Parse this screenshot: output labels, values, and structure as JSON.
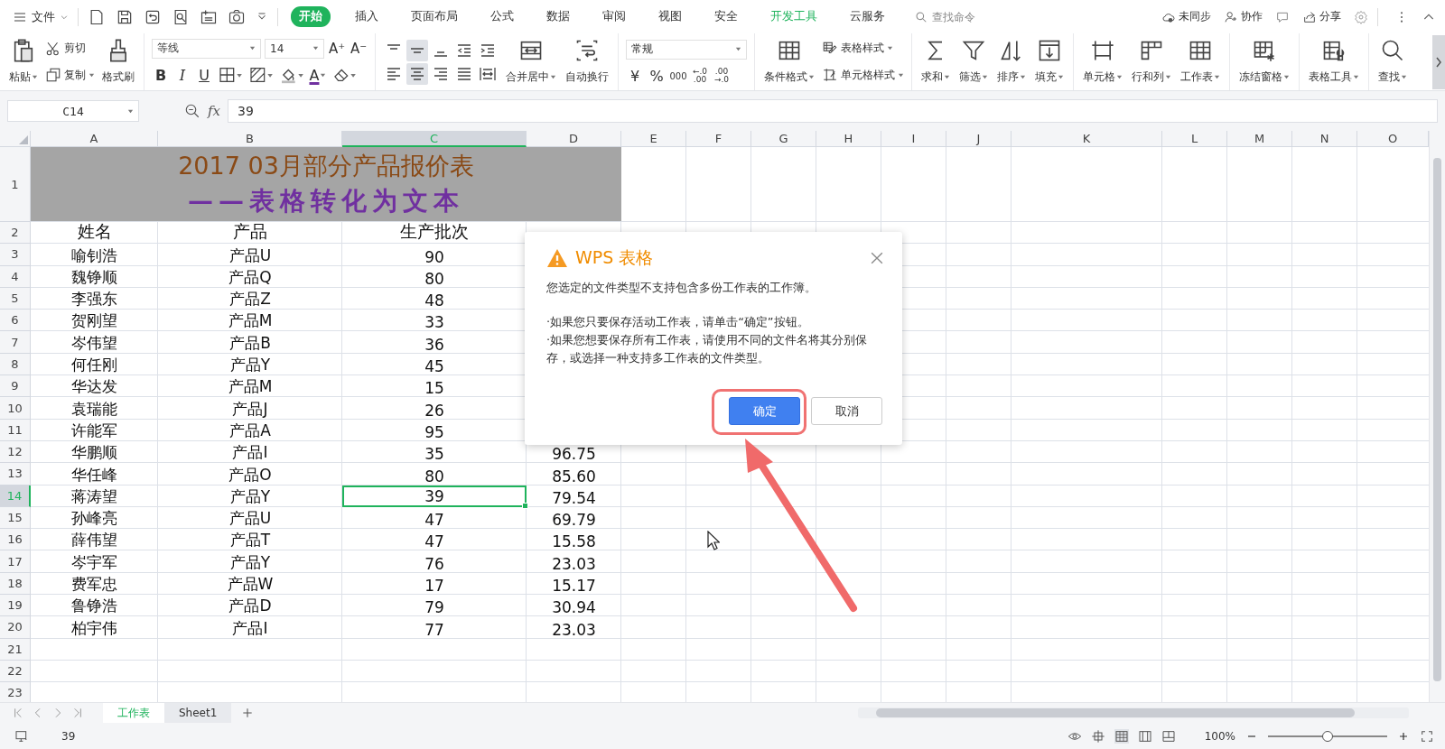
{
  "menu_bar": {
    "file_menu": "文件",
    "tabs": [
      {
        "label": "开始",
        "selected": true,
        "kind": "normal"
      },
      {
        "label": "插入",
        "selected": false,
        "kind": "normal"
      },
      {
        "label": "页面布局",
        "selected": false,
        "kind": "normal"
      },
      {
        "label": "公式",
        "selected": false,
        "kind": "normal"
      },
      {
        "label": "数据",
        "selected": false,
        "kind": "normal"
      },
      {
        "label": "审阅",
        "selected": false,
        "kind": "normal"
      },
      {
        "label": "视图",
        "selected": false,
        "kind": "normal"
      },
      {
        "label": "安全",
        "selected": false,
        "kind": "normal"
      },
      {
        "label": "开发工具",
        "selected": false,
        "kind": "accent"
      },
      {
        "label": "云服务",
        "selected": false,
        "kind": "normal"
      }
    ],
    "search": {
      "placeholder": "查找命令"
    },
    "actions": [
      "未同步",
      "协作",
      "分享"
    ]
  },
  "ribbon": {
    "groups": [
      {
        "items": [
          {
            "kind": "large",
            "label": "粘贴",
            "dropdown": true
          },
          {
            "kind": "stack",
            "items": [
              {
                "label": "剪切",
                "dropdown": false
              },
              {
                "label": "复制",
                "dropdown": true
              }
            ]
          },
          {
            "kind": "large",
            "label": "格式刷",
            "dropdown": false
          }
        ]
      },
      {
        "items": [
          {
            "kind": "font",
            "font": "等线",
            "size": "14",
            "size_buttons": [
              "A⁺",
              "A⁻"
            ],
            "styles": [
              "B",
              "I",
              "U"
            ],
            "font_color_glyph": "A"
          }
        ]
      },
      {
        "items": [
          {
            "kind": "align",
            "buttons": [
              {
                "selected": false
              },
              {
                "selected": true
              },
              {
                "selected": false
              },
              {
                "selected": false
              },
              {
                "selected": false
              },
              {
                "selected": false
              },
              {
                "selected": true
              },
              {
                "selected": false
              },
              {
                "selected": false
              },
              {
                "selected": false
              }
            ]
          },
          {
            "kind": "large",
            "label": "合并居中",
            "dropdown": true
          },
          {
            "kind": "large",
            "label": "自动换行",
            "dropdown": false
          }
        ]
      },
      {
        "items": [
          {
            "kind": "number",
            "format": "常规",
            "symbols": [
              "¥",
              "%"
            ],
            "thousands": "000",
            "decimals": [
              {
                "top": "←.0",
                "bottom": ".00"
              },
              {
                "top": ".00",
                "bottom": "→.0"
              }
            ]
          }
        ]
      },
      {
        "items": [
          {
            "kind": "large",
            "label": "条件格式",
            "dropdown": true
          },
          {
            "kind": "stack",
            "items": [
              {
                "label": "表格样式",
                "dropdown": true
              },
              {
                "label": "单元格样式",
                "dropdown": true
              }
            ]
          }
        ]
      },
      {
        "items": [
          {
            "kind": "large",
            "label": "求和",
            "dropdown": true
          },
          {
            "kind": "large",
            "label": "筛选",
            "dropdown": true
          },
          {
            "kind": "large",
            "label": "排序",
            "dropdown": true
          },
          {
            "kind": "large",
            "label": "填充",
            "dropdown": true
          }
        ]
      },
      {
        "items": [
          {
            "kind": "large",
            "label": "单元格",
            "dropdown": true
          },
          {
            "kind": "large",
            "label": "行和列",
            "dropdown": true
          },
          {
            "kind": "large",
            "label": "工作表",
            "dropdown": true
          }
        ]
      },
      {
        "items": [
          {
            "kind": "large",
            "label": "冻结窗格",
            "dropdown": true
          }
        ]
      },
      {
        "items": [
          {
            "kind": "large",
            "label": "表格工具",
            "dropdown": true
          }
        ]
      },
      {
        "items": [
          {
            "kind": "large",
            "label": "查找",
            "dropdown": true
          }
        ]
      }
    ]
  },
  "formula_bar": {
    "cell_ref": "C14",
    "fx": "fx",
    "value": "39"
  },
  "sheet": {
    "columns": [
      {
        "label": "A",
        "selected": false
      },
      {
        "label": "B",
        "selected": false
      },
      {
        "label": "C",
        "selected": true
      },
      {
        "label": "D",
        "selected": false
      },
      {
        "label": "E",
        "selected": false
      },
      {
        "label": "F",
        "selected": false
      },
      {
        "label": "G",
        "selected": false
      },
      {
        "label": "H",
        "selected": false
      },
      {
        "label": "I",
        "selected": false
      },
      {
        "label": "J",
        "selected": false
      },
      {
        "label": "K",
        "selected": false
      },
      {
        "label": "L",
        "selected": false
      },
      {
        "label": "M",
        "selected": false
      },
      {
        "label": "N",
        "selected": false
      },
      {
        "label": "O",
        "selected": false
      }
    ],
    "rows": [
      {
        "number": "1",
        "selected": false,
        "kind": "title",
        "title": "2017 03月部分产品报价表",
        "subtitle": "——表格转化为文本"
      },
      {
        "number": "2",
        "selected": false,
        "kind": "header",
        "cells": [
          "姓名",
          "产品",
          "生产批次"
        ]
      },
      {
        "number": "3",
        "selected": false,
        "kind": "data",
        "cells": [
          "喻钊浩",
          "产品U",
          "90"
        ]
      },
      {
        "number": "4",
        "selected": false,
        "kind": "data",
        "cells": [
          "魏铮顺",
          "产品Q",
          "80"
        ]
      },
      {
        "number": "5",
        "selected": false,
        "kind": "data",
        "cells": [
          "李强东",
          "产品Z",
          "48"
        ]
      },
      {
        "number": "6",
        "selected": false,
        "kind": "data",
        "cells": [
          "贺刚望",
          "产品M",
          "33"
        ]
      },
      {
        "number": "7",
        "selected": false,
        "kind": "data",
        "cells": [
          "岑伟望",
          "产品B",
          "36"
        ]
      },
      {
        "number": "8",
        "selected": false,
        "kind": "data",
        "cells": [
          "何任刚",
          "产品Y",
          "45"
        ]
      },
      {
        "number": "9",
        "selected": false,
        "kind": "data",
        "cells": [
          "华达发",
          "产品M",
          "15"
        ]
      },
      {
        "number": "10",
        "selected": false,
        "kind": "data",
        "cells": [
          "袁瑞能",
          "产品J",
          "26"
        ]
      },
      {
        "number": "11",
        "selected": false,
        "kind": "data",
        "cells": [
          "许能军",
          "产品A",
          "95"
        ]
      },
      {
        "number": "12",
        "selected": false,
        "kind": "data",
        "cells": [
          "华鹏顺",
          "产品I",
          "35",
          "96.75"
        ]
      },
      {
        "number": "13",
        "selected": false,
        "kind": "data",
        "cells": [
          "华任峰",
          "产品O",
          "80",
          "85.60"
        ]
      },
      {
        "number": "14",
        "selected": true,
        "kind": "data",
        "cells": [
          "蒋涛望",
          "产品Y",
          "39",
          "79.54"
        ]
      },
      {
        "number": "15",
        "selected": false,
        "kind": "data",
        "cells": [
          "孙峰亮",
          "产品U",
          "47",
          "69.79"
        ]
      },
      {
        "number": "16",
        "selected": false,
        "kind": "data",
        "cells": [
          "薛伟望",
          "产品T",
          "47",
          "15.58"
        ]
      },
      {
        "number": "17",
        "selected": false,
        "kind": "data",
        "cells": [
          "岑宇军",
          "产品Y",
          "76",
          "23.03"
        ]
      },
      {
        "number": "18",
        "selected": false,
        "kind": "data",
        "cells": [
          "费军忠",
          "产品W",
          "17",
          "15.17"
        ]
      },
      {
        "number": "19",
        "selected": false,
        "kind": "data",
        "cells": [
          "鲁铮浩",
          "产品D",
          "79",
          "30.94"
        ]
      },
      {
        "number": "20",
        "selected": false,
        "kind": "data",
        "cells": [
          "柏宇伟",
          "产品I",
          "77",
          "23.03"
        ]
      },
      {
        "number": "21",
        "selected": false,
        "kind": "data"
      },
      {
        "number": "22",
        "selected": false,
        "kind": "data"
      },
      {
        "number": "23",
        "selected": false,
        "kind": "data"
      }
    ]
  },
  "sheet_tabs": [
    {
      "label": "工作表",
      "selected": true
    },
    {
      "label": "Sheet1",
      "selected": false
    }
  ],
  "status_bar": {
    "value": "39",
    "zoom": "100%",
    "zoom_slider": {
      "level": 0.5
    }
  },
  "dialog": {
    "title": "WPS 表格",
    "message": [
      "您选定的文件类型不支持包含多份工作表的工作簿。",
      "·如果您只要保存活动工作表，请单击“确定”按钮。",
      "·如果您想要保存所有工作表，请使用不同的文件名将其分别保存，或选择一种支持多工作表的文件类型。"
    ],
    "buttons": [
      {
        "label": "确定",
        "kind": "primary"
      },
      {
        "label": "取消",
        "kind": "secondary"
      }
    ]
  }
}
